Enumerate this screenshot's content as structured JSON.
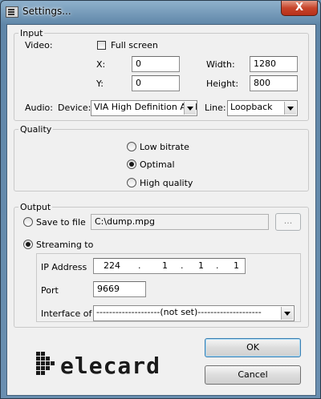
{
  "window": {
    "title": "Settings...",
    "close_label": "X"
  },
  "input": {
    "legend": "Input",
    "video_label": "Video:",
    "fullscreen_label": "Full screen",
    "fullscreen_checked": false,
    "x_label": "X:",
    "x_value": "0",
    "y_label": "Y:",
    "y_value": "0",
    "width_label": "Width:",
    "width_value": "1280",
    "height_label": "Height:",
    "height_value": "800",
    "audio_label": "Audio:",
    "device_label": "Device:",
    "device_value": "VIA High Definition Audi",
    "line_label": "Line:",
    "line_value": "Loopback"
  },
  "quality": {
    "legend": "Quality",
    "options": [
      "Low bitrate",
      "Optimal",
      "High quality"
    ],
    "selected": "Optimal"
  },
  "output": {
    "legend": "Output",
    "save_to_file_label": "Save to file",
    "file_path": "C:\\dump.mpg",
    "browse_label": "...",
    "streaming_label": "Streaming to",
    "selected": "Streaming to",
    "ip_label": "IP Address",
    "ip": [
      "224",
      "1",
      "1",
      "1"
    ],
    "ip_separator": ".",
    "port_label": "Port",
    "port_value": "9669",
    "interface_label": "Interface of",
    "interface_value": "--------------------(not set)--------------------"
  },
  "buttons": {
    "ok": "OK",
    "cancel": "Cancel"
  },
  "logo": {
    "text": "elecard"
  },
  "colors": {
    "logo": "#1a1a1a",
    "close": "#c7442a"
  }
}
